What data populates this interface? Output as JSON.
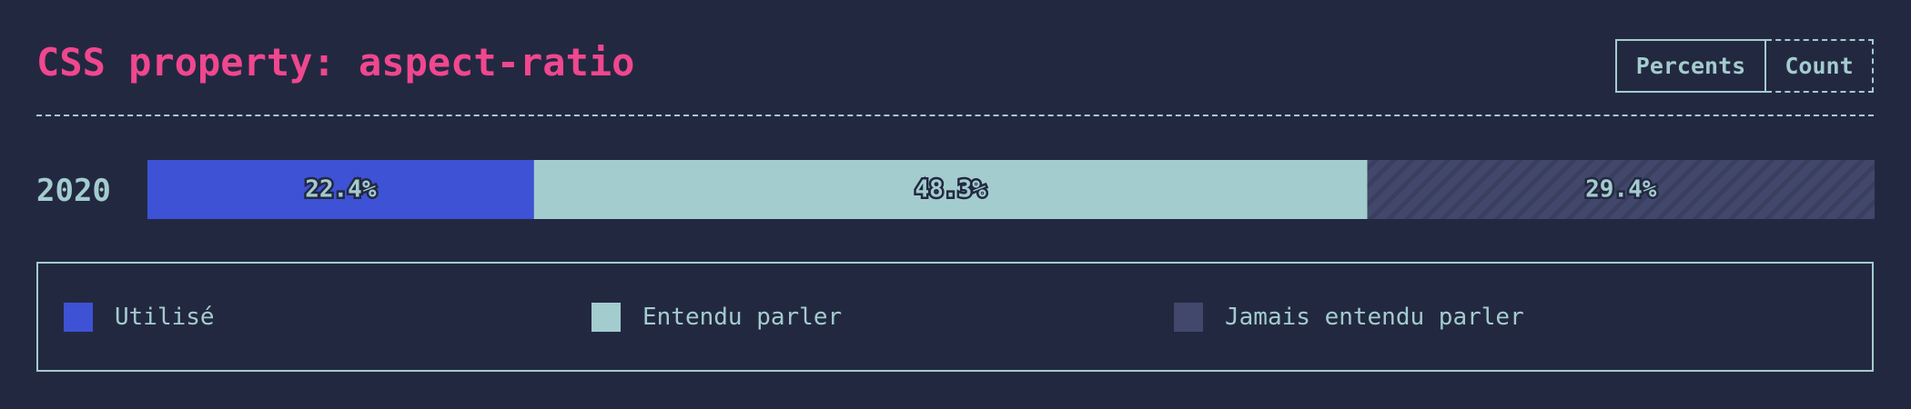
{
  "title": "CSS property: aspect-ratio",
  "toggle": {
    "percents_label": "Percents",
    "count_label": "Count",
    "selected": "Percents"
  },
  "colors": {
    "background": "#232841",
    "title": "#f0478f",
    "text": "#a3ccce",
    "used": "#3d52d5",
    "heard": "#a3ccce",
    "never": "#42486b"
  },
  "chart_data": {
    "type": "bar",
    "stacked": true,
    "orientation": "horizontal",
    "categories": [
      "2020"
    ],
    "unit": "%",
    "series": [
      {
        "name": "Utilisé",
        "values": [
          22.4
        ],
        "label": "22.4%",
        "color": "#3d52d5"
      },
      {
        "name": "Entendu parler",
        "values": [
          48.3
        ],
        "label": "48.3%",
        "color": "#a3ccce"
      },
      {
        "name": "Jamais entendu parler",
        "values": [
          29.4
        ],
        "label": "29.4%",
        "color": "#42486b",
        "pattern": "diagonal-stripes"
      }
    ],
    "xlim": [
      0,
      100.1
    ],
    "legend_position": "bottom"
  }
}
